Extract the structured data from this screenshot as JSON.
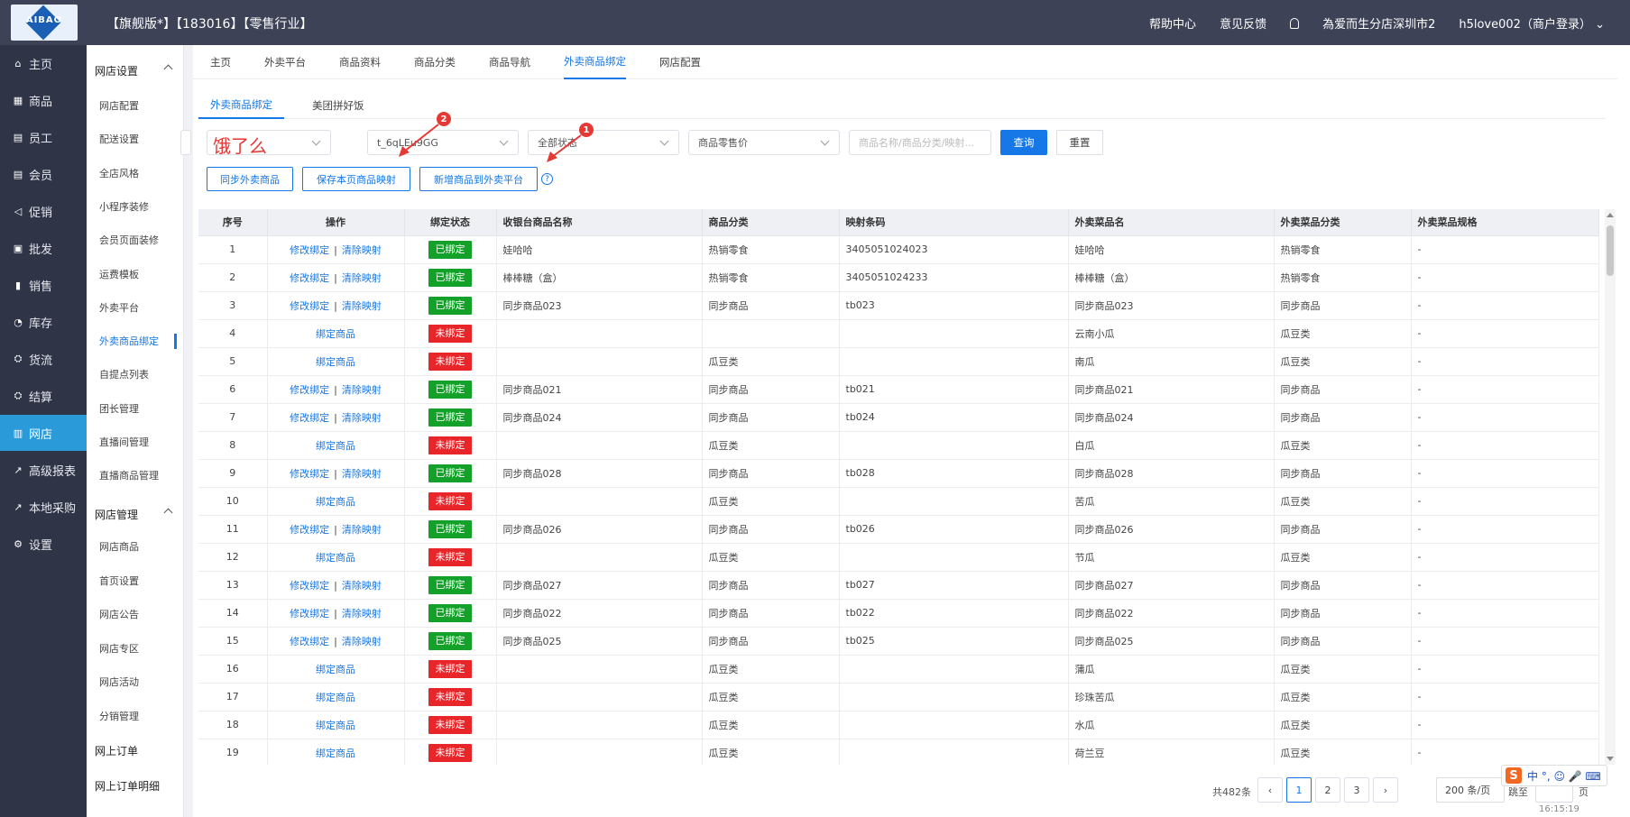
{
  "header": {
    "logo_text": "AIBAO",
    "title": "【旗舰版*】【183016】【零售行业】",
    "help": "帮助中心",
    "feedback": "意见反馈",
    "store": "為爱而生分店深圳市2",
    "user": "h5love002（商户登录）"
  },
  "sidebar": {
    "items": [
      {
        "label": "主页",
        "icon": "⌂"
      },
      {
        "label": "商品",
        "icon": "▦"
      },
      {
        "label": "员工",
        "icon": "▤"
      },
      {
        "label": "会员",
        "icon": "▤"
      },
      {
        "label": "促销",
        "icon": "◁"
      },
      {
        "label": "批发",
        "icon": "▣"
      },
      {
        "label": "销售",
        "icon": "▮"
      },
      {
        "label": "库存",
        "icon": "◔"
      },
      {
        "label": "货流",
        "icon": "⛭"
      },
      {
        "label": "结算",
        "icon": "⛭"
      },
      {
        "label": "网店",
        "icon": "▥"
      },
      {
        "label": "高级报表",
        "icon": "↗"
      },
      {
        "label": "本地采购",
        "icon": "↗"
      },
      {
        "label": "设置",
        "icon": "⚙"
      }
    ]
  },
  "subsidebar": {
    "group1": "网店设置",
    "group1_items": [
      "网店配置",
      "配送设置",
      "全店风格",
      "小程序装修",
      "会员页面装修",
      "运费模板",
      "外卖平台",
      "外卖商品绑定",
      "自提点列表",
      "团长管理",
      "直播间管理",
      "直播商品管理"
    ],
    "group2": "网店管理",
    "group2_items": [
      "网店商品",
      "首页设置",
      "网店公告",
      "网店专区",
      "网店活动",
      "分销管理"
    ],
    "group3_items": [
      "网上订单",
      "网上订单明细"
    ]
  },
  "nav_tabs": [
    "主页",
    "外卖平台",
    "商品资料",
    "商品分类",
    "商品导航",
    "外卖商品绑定",
    "网店配置"
  ],
  "sub_tabs": [
    "外卖商品绑定",
    "美团拼好饭"
  ],
  "filters": {
    "platform": "饿了么",
    "shop_code": "t_6qLEu9GG",
    "status": "全部状态",
    "price": "商品零售价",
    "search_placeholder": "商品名称/商品分类/映射...",
    "query": "查询",
    "reset": "重置"
  },
  "actions": {
    "sync": "同步外卖商品",
    "save_mapping": "保存本页商品映射",
    "add_to_platform": "新增商品到外卖平台",
    "help": "?"
  },
  "annotations": {
    "text": "饿了么",
    "marker1": "1",
    "marker2": "2"
  },
  "table": {
    "headers": [
      "序号",
      "操作",
      "绑定状态",
      "收银台商品名称",
      "商品分类",
      "映射条码",
      "外卖菜品名",
      "外卖菜品分类",
      "外卖菜品规格"
    ],
    "edit_label": "修改绑定",
    "sep": "|",
    "clear_label": "清除映射",
    "bind_label": "绑定商品",
    "bound_label": "已绑定",
    "unbound_label": "未绑定",
    "rows": [
      {
        "no": "1",
        "bound": true,
        "name": "娃哈哈",
        "category": "热销零食",
        "barcode": "3405051024023",
        "dish": "娃哈哈",
        "dish_category": "热销零食",
        "spec": "-"
      },
      {
        "no": "2",
        "bound": true,
        "name": "棒棒糖（盒）",
        "category": "热销零食",
        "barcode": "3405051024233",
        "dish": "棒棒糖（盒）",
        "dish_category": "热销零食",
        "spec": "-"
      },
      {
        "no": "3",
        "bound": true,
        "name": "同步商品023",
        "category": "同步商品",
        "barcode": "tb023",
        "dish": "同步商品023",
        "dish_category": "同步商品",
        "spec": "-"
      },
      {
        "no": "4",
        "bound": false,
        "name": "",
        "category": "",
        "barcode": "",
        "dish": "云南小瓜",
        "dish_category": "瓜豆类",
        "spec": "-"
      },
      {
        "no": "5",
        "bound": false,
        "name": "",
        "category": "瓜豆类",
        "barcode": "",
        "dish": "南瓜",
        "dish_category": "瓜豆类",
        "spec": "-"
      },
      {
        "no": "6",
        "bound": true,
        "name": "同步商品021",
        "category": "同步商品",
        "barcode": "tb021",
        "dish": "同步商品021",
        "dish_category": "同步商品",
        "spec": "-"
      },
      {
        "no": "7",
        "bound": true,
        "name": "同步商品024",
        "category": "同步商品",
        "barcode": "tb024",
        "dish": "同步商品024",
        "dish_category": "同步商品",
        "spec": "-"
      },
      {
        "no": "8",
        "bound": false,
        "name": "",
        "category": "瓜豆类",
        "barcode": "",
        "dish": "白瓜",
        "dish_category": "瓜豆类",
        "spec": "-"
      },
      {
        "no": "9",
        "bound": true,
        "name": "同步商品028",
        "category": "同步商品",
        "barcode": "tb028",
        "dish": "同步商品028",
        "dish_category": "同步商品",
        "spec": "-"
      },
      {
        "no": "10",
        "bound": false,
        "name": "",
        "category": "瓜豆类",
        "barcode": "",
        "dish": "苦瓜",
        "dish_category": "瓜豆类",
        "spec": "-"
      },
      {
        "no": "11",
        "bound": true,
        "name": "同步商品026",
        "category": "同步商品",
        "barcode": "tb026",
        "dish": "同步商品026",
        "dish_category": "同步商品",
        "spec": "-"
      },
      {
        "no": "12",
        "bound": false,
        "name": "",
        "category": "瓜豆类",
        "barcode": "",
        "dish": "节瓜",
        "dish_category": "瓜豆类",
        "spec": "-"
      },
      {
        "no": "13",
        "bound": true,
        "name": "同步商品027",
        "category": "同步商品",
        "barcode": "tb027",
        "dish": "同步商品027",
        "dish_category": "同步商品",
        "spec": "-"
      },
      {
        "no": "14",
        "bound": true,
        "name": "同步商品022",
        "category": "同步商品",
        "barcode": "tb022",
        "dish": "同步商品022",
        "dish_category": "同步商品",
        "spec": "-"
      },
      {
        "no": "15",
        "bound": true,
        "name": "同步商品025",
        "category": "同步商品",
        "barcode": "tb025",
        "dish": "同步商品025",
        "dish_category": "同步商品",
        "spec": "-"
      },
      {
        "no": "16",
        "bound": false,
        "name": "",
        "category": "瓜豆类",
        "barcode": "",
        "dish": "蒲瓜",
        "dish_category": "瓜豆类",
        "spec": "-"
      },
      {
        "no": "17",
        "bound": false,
        "name": "",
        "category": "瓜豆类",
        "barcode": "",
        "dish": "珍珠苦瓜",
        "dish_category": "瓜豆类",
        "spec": "-"
      },
      {
        "no": "18",
        "bound": false,
        "name": "",
        "category": "瓜豆类",
        "barcode": "",
        "dish": "水瓜",
        "dish_category": "瓜豆类",
        "spec": "-"
      },
      {
        "no": "19",
        "bound": false,
        "name": "",
        "category": "瓜豆类",
        "barcode": "",
        "dish": "荷兰豆",
        "dish_category": "瓜豆类",
        "spec": "-"
      }
    ]
  },
  "pagination": {
    "total": "共482条",
    "prev": "‹",
    "pages": [
      "1",
      "2",
      "3"
    ],
    "next": "›",
    "page_size": "200 条/页",
    "jump": "跳至",
    "suffix": "页"
  },
  "ime": {
    "logo": "S",
    "label": "中 °, ☺ 🎤 ⌨"
  },
  "clock": "16:15:19",
  "colors": {
    "primary": "#1677e6",
    "bound": "#13a12a",
    "unbound": "#e8262a",
    "header": "#3d4257",
    "sidebar": "#2f3447",
    "active": "#2a9bd8"
  }
}
